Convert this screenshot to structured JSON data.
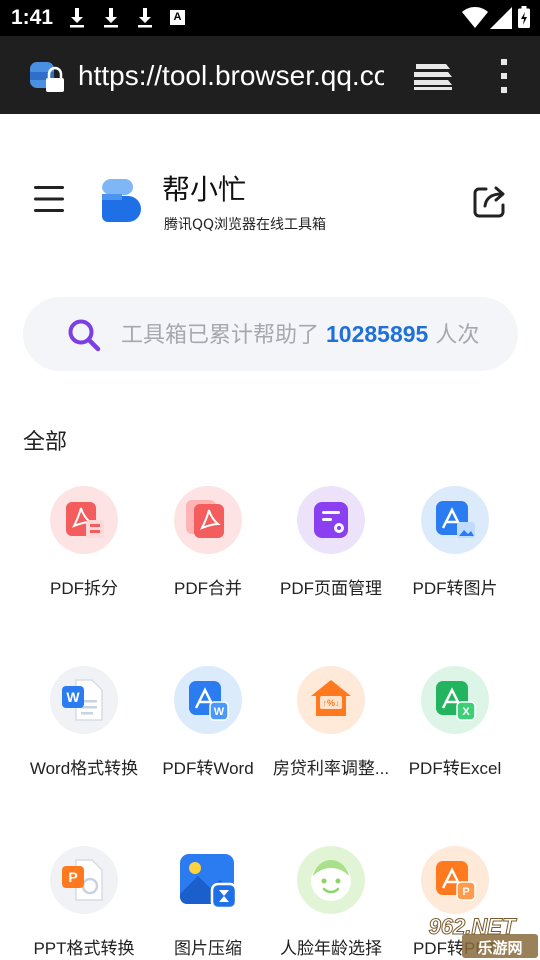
{
  "status_bar": {
    "time": "1:41",
    "notification_icons": [
      "download-icon",
      "download-icon",
      "download-icon",
      "a-icon"
    ],
    "a_icon_text": "A",
    "system_icons": [
      "wifi-icon",
      "signal-icon",
      "battery-icon"
    ]
  },
  "browser": {
    "url": "https://tool.browser.qq.com/",
    "site_icon": "lock-icon",
    "tabs_icon": "tabs-icon",
    "menu_icon": "more-vert-icon"
  },
  "header": {
    "app_name": "帮小忙",
    "app_subtitle": "腾讯QQ浏览器在线工具箱",
    "menu_icon": "hamburger-icon",
    "share_icon": "share-icon"
  },
  "search": {
    "prefix": "工具箱已累计帮助了 ",
    "count": "10285895",
    "suffix": " 人次"
  },
  "section": {
    "title": "全部"
  },
  "tools": [
    {
      "label": "PDF拆分",
      "icon": "pdf-split-icon",
      "bg": "#fde3e3",
      "fg": "#f45d5d"
    },
    {
      "label": "PDF合并",
      "icon": "pdf-merge-icon",
      "bg": "#fde3e3",
      "fg": "#f45d5d"
    },
    {
      "label": "PDF页面管理",
      "icon": "pdf-page-manage-icon",
      "bg": "#ece3fb",
      "fg": "#8a3ff0"
    },
    {
      "label": "PDF转图片",
      "icon": "pdf-to-image-icon",
      "bg": "#dcebfc",
      "fg": "#2b7cf0"
    },
    {
      "label": "Word格式转换",
      "icon": "word-convert-icon",
      "bg": "#f0f2f5",
      "fg": "#2b7cf0"
    },
    {
      "label": "PDF转Word",
      "icon": "pdf-to-word-icon",
      "bg": "#dcebfc",
      "fg": "#2b7cf0"
    },
    {
      "label": "房贷利率调整...",
      "icon": "mortgage-rate-icon",
      "bg": "#ffe9d9",
      "fg": "#ff7a1f"
    },
    {
      "label": "PDF转Excel",
      "icon": "pdf-to-excel-icon",
      "bg": "#dcf5e6",
      "fg": "#22b45f"
    },
    {
      "label": "PPT格式转换",
      "icon": "ppt-convert-icon",
      "bg": "#f0f2f5",
      "fg": "#ff7a1f"
    },
    {
      "label": "图片压缩",
      "icon": "image-compress-icon",
      "bg": "#ffffff",
      "fg": "#2b7cf0"
    },
    {
      "label": "人脸年龄选择",
      "icon": "face-age-icon",
      "bg": "#e1f5d6",
      "fg": "#8bd46a"
    },
    {
      "label": "PDF转PPT",
      "icon": "pdf-to-ppt-icon",
      "bg": "#ffe9d9",
      "fg": "#ff7a1f"
    }
  ],
  "watermark": {
    "text_top": "962.NET",
    "text_bottom": "乐游网"
  },
  "colors": {
    "accent": "#1f70d8",
    "status_bar": "#000000",
    "browser_bar": "#1f1f1f",
    "search_bg": "#f4f5f8"
  }
}
